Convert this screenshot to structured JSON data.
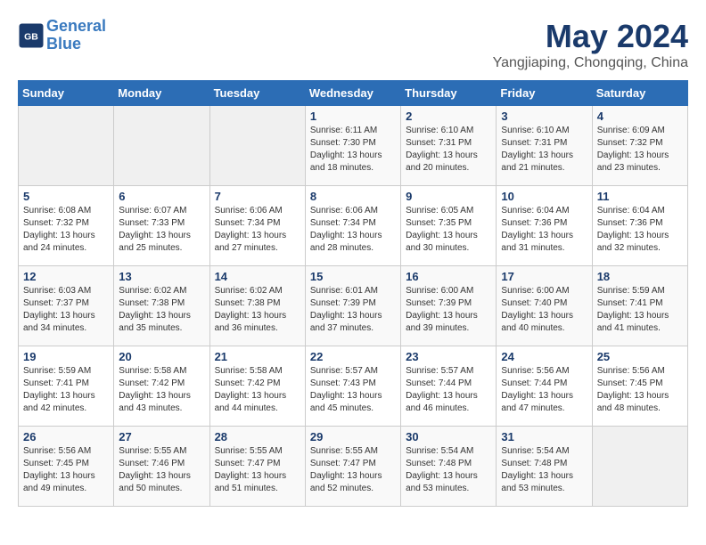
{
  "header": {
    "logo_line1": "General",
    "logo_line2": "Blue",
    "month": "May 2024",
    "location": "Yangjiaping, Chongqing, China"
  },
  "days_of_week": [
    "Sunday",
    "Monday",
    "Tuesday",
    "Wednesday",
    "Thursday",
    "Friday",
    "Saturday"
  ],
  "weeks": [
    [
      {
        "day": "",
        "info": ""
      },
      {
        "day": "",
        "info": ""
      },
      {
        "day": "",
        "info": ""
      },
      {
        "day": "1",
        "info": "Sunrise: 6:11 AM\nSunset: 7:30 PM\nDaylight: 13 hours\nand 18 minutes."
      },
      {
        "day": "2",
        "info": "Sunrise: 6:10 AM\nSunset: 7:31 PM\nDaylight: 13 hours\nand 20 minutes."
      },
      {
        "day": "3",
        "info": "Sunrise: 6:10 AM\nSunset: 7:31 PM\nDaylight: 13 hours\nand 21 minutes."
      },
      {
        "day": "4",
        "info": "Sunrise: 6:09 AM\nSunset: 7:32 PM\nDaylight: 13 hours\nand 23 minutes."
      }
    ],
    [
      {
        "day": "5",
        "info": "Sunrise: 6:08 AM\nSunset: 7:32 PM\nDaylight: 13 hours\nand 24 minutes."
      },
      {
        "day": "6",
        "info": "Sunrise: 6:07 AM\nSunset: 7:33 PM\nDaylight: 13 hours\nand 25 minutes."
      },
      {
        "day": "7",
        "info": "Sunrise: 6:06 AM\nSunset: 7:34 PM\nDaylight: 13 hours\nand 27 minutes."
      },
      {
        "day": "8",
        "info": "Sunrise: 6:06 AM\nSunset: 7:34 PM\nDaylight: 13 hours\nand 28 minutes."
      },
      {
        "day": "9",
        "info": "Sunrise: 6:05 AM\nSunset: 7:35 PM\nDaylight: 13 hours\nand 30 minutes."
      },
      {
        "day": "10",
        "info": "Sunrise: 6:04 AM\nSunset: 7:36 PM\nDaylight: 13 hours\nand 31 minutes."
      },
      {
        "day": "11",
        "info": "Sunrise: 6:04 AM\nSunset: 7:36 PM\nDaylight: 13 hours\nand 32 minutes."
      }
    ],
    [
      {
        "day": "12",
        "info": "Sunrise: 6:03 AM\nSunset: 7:37 PM\nDaylight: 13 hours\nand 34 minutes."
      },
      {
        "day": "13",
        "info": "Sunrise: 6:02 AM\nSunset: 7:38 PM\nDaylight: 13 hours\nand 35 minutes."
      },
      {
        "day": "14",
        "info": "Sunrise: 6:02 AM\nSunset: 7:38 PM\nDaylight: 13 hours\nand 36 minutes."
      },
      {
        "day": "15",
        "info": "Sunrise: 6:01 AM\nSunset: 7:39 PM\nDaylight: 13 hours\nand 37 minutes."
      },
      {
        "day": "16",
        "info": "Sunrise: 6:00 AM\nSunset: 7:39 PM\nDaylight: 13 hours\nand 39 minutes."
      },
      {
        "day": "17",
        "info": "Sunrise: 6:00 AM\nSunset: 7:40 PM\nDaylight: 13 hours\nand 40 minutes."
      },
      {
        "day": "18",
        "info": "Sunrise: 5:59 AM\nSunset: 7:41 PM\nDaylight: 13 hours\nand 41 minutes."
      }
    ],
    [
      {
        "day": "19",
        "info": "Sunrise: 5:59 AM\nSunset: 7:41 PM\nDaylight: 13 hours\nand 42 minutes."
      },
      {
        "day": "20",
        "info": "Sunrise: 5:58 AM\nSunset: 7:42 PM\nDaylight: 13 hours\nand 43 minutes."
      },
      {
        "day": "21",
        "info": "Sunrise: 5:58 AM\nSunset: 7:42 PM\nDaylight: 13 hours\nand 44 minutes."
      },
      {
        "day": "22",
        "info": "Sunrise: 5:57 AM\nSunset: 7:43 PM\nDaylight: 13 hours\nand 45 minutes."
      },
      {
        "day": "23",
        "info": "Sunrise: 5:57 AM\nSunset: 7:44 PM\nDaylight: 13 hours\nand 46 minutes."
      },
      {
        "day": "24",
        "info": "Sunrise: 5:56 AM\nSunset: 7:44 PM\nDaylight: 13 hours\nand 47 minutes."
      },
      {
        "day": "25",
        "info": "Sunrise: 5:56 AM\nSunset: 7:45 PM\nDaylight: 13 hours\nand 48 minutes."
      }
    ],
    [
      {
        "day": "26",
        "info": "Sunrise: 5:56 AM\nSunset: 7:45 PM\nDaylight: 13 hours\nand 49 minutes."
      },
      {
        "day": "27",
        "info": "Sunrise: 5:55 AM\nSunset: 7:46 PM\nDaylight: 13 hours\nand 50 minutes."
      },
      {
        "day": "28",
        "info": "Sunrise: 5:55 AM\nSunset: 7:47 PM\nDaylight: 13 hours\nand 51 minutes."
      },
      {
        "day": "29",
        "info": "Sunrise: 5:55 AM\nSunset: 7:47 PM\nDaylight: 13 hours\nand 52 minutes."
      },
      {
        "day": "30",
        "info": "Sunrise: 5:54 AM\nSunset: 7:48 PM\nDaylight: 13 hours\nand 53 minutes."
      },
      {
        "day": "31",
        "info": "Sunrise: 5:54 AM\nSunset: 7:48 PM\nDaylight: 13 hours\nand 53 minutes."
      },
      {
        "day": "",
        "info": ""
      }
    ]
  ]
}
